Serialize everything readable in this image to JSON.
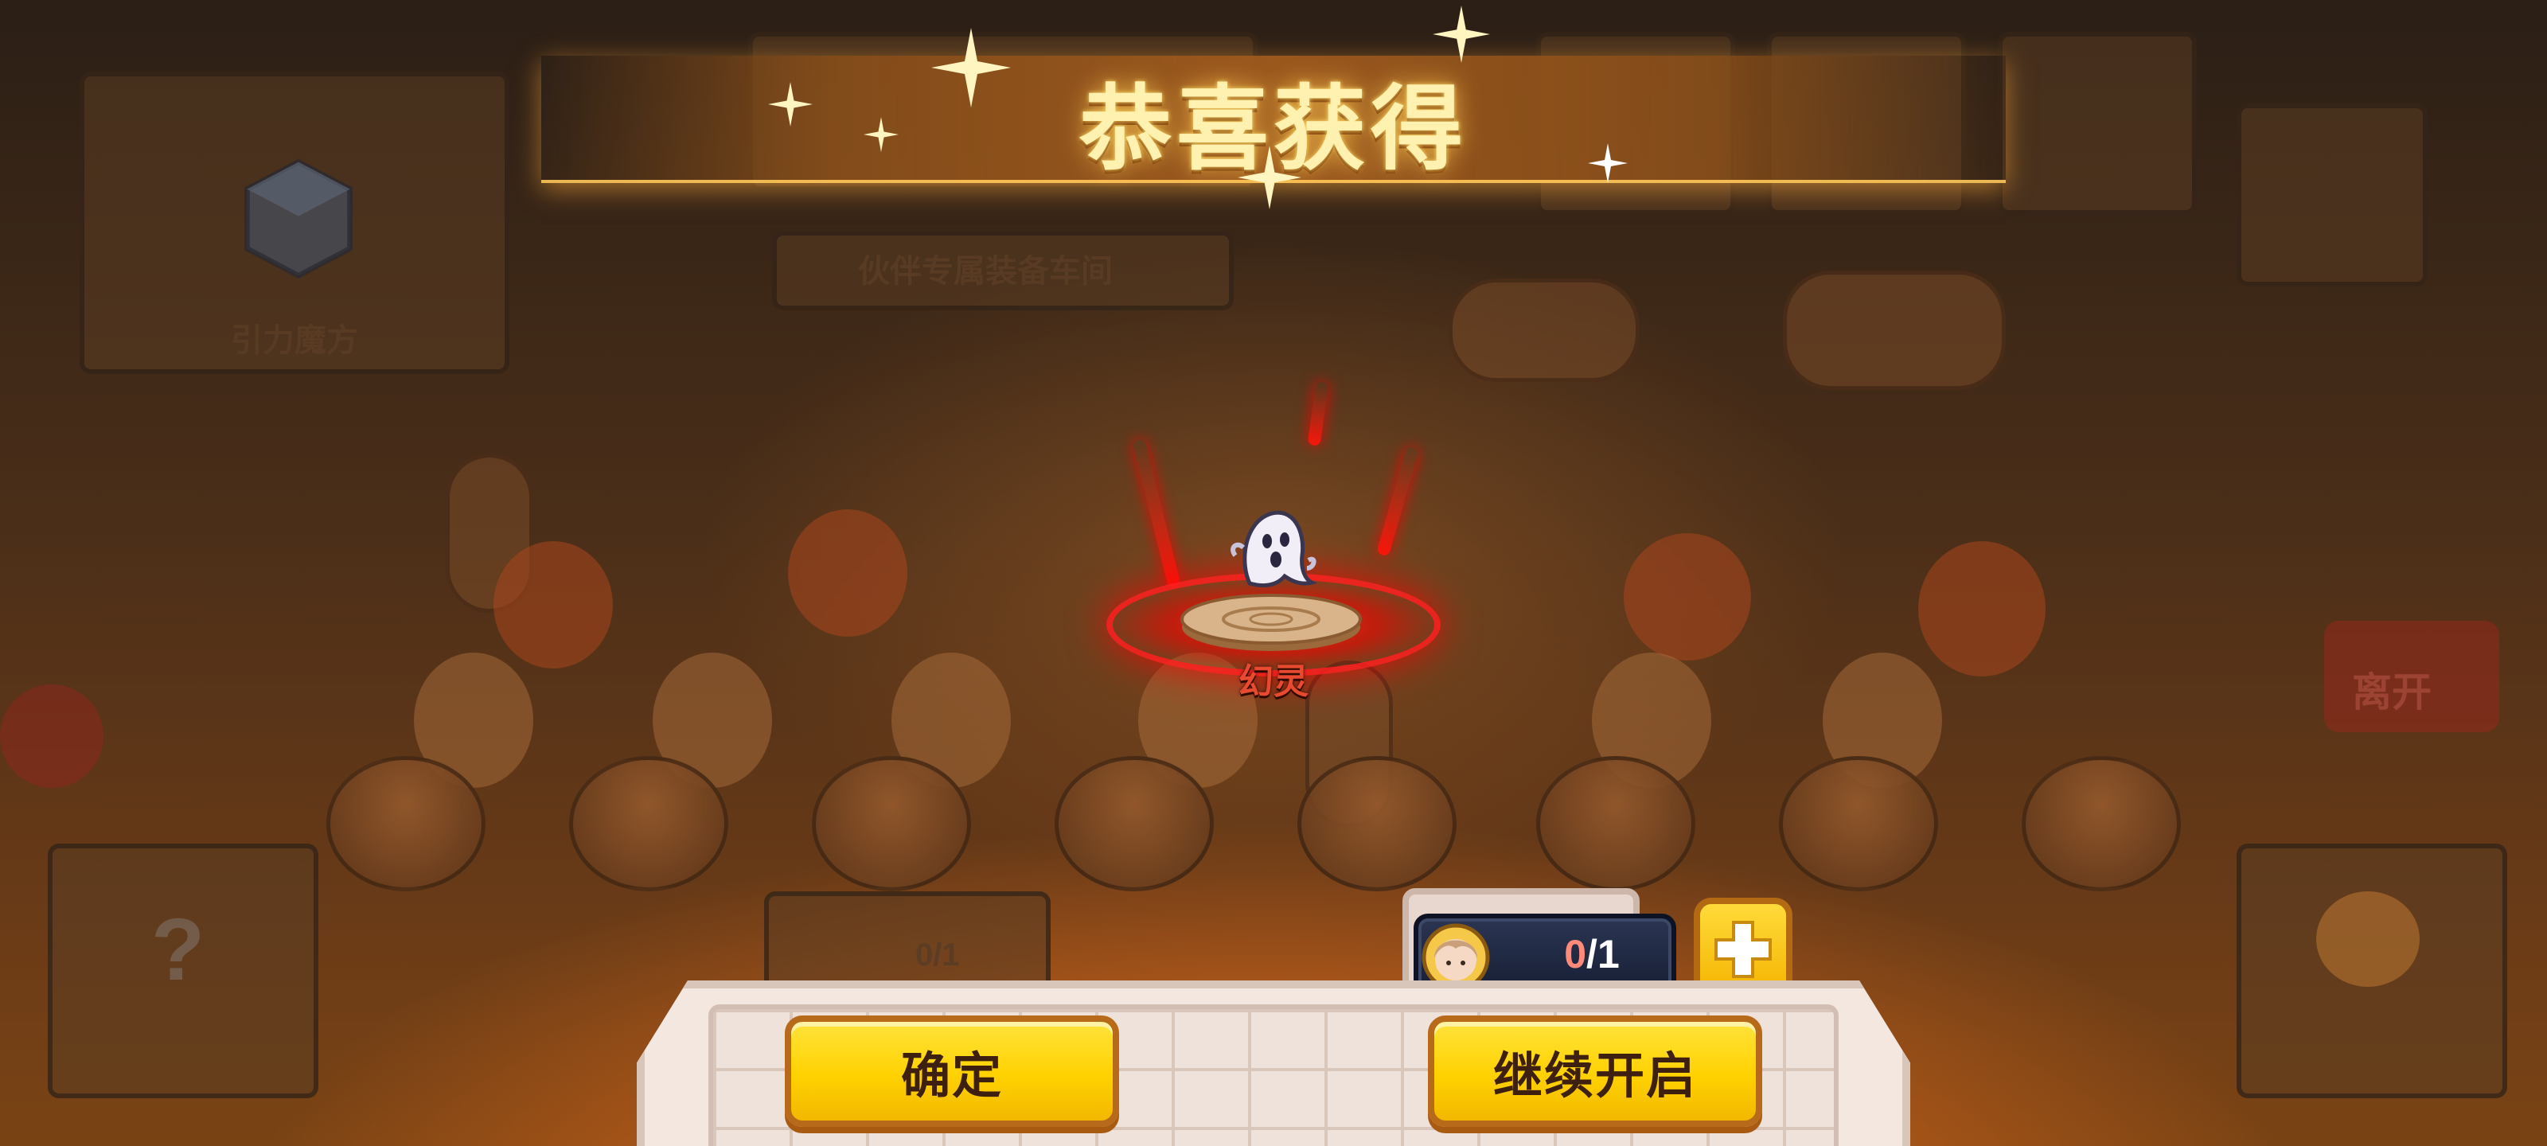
{
  "banner": {
    "title": "恭喜获得"
  },
  "background": {
    "workshop_label": "伙伴专属装备车间",
    "gravity_label": "引力魔方",
    "leave_label": "离开",
    "slot_count": "0/1"
  },
  "reward": {
    "name": "幻灵",
    "icon": "ghost-pet-icon",
    "glow_color": "#ff1a0a"
  },
  "counter": {
    "have": "0",
    "total": "/1",
    "avatar_icon": "hero-avatar-icon"
  },
  "buttons": {
    "confirm": "确定",
    "continue": "继续开启",
    "add_icon": "plus-icon"
  },
  "colors": {
    "button_yellow": "#ffd100",
    "button_border": "#b76a1a",
    "title_gold": "#fff2b0"
  }
}
